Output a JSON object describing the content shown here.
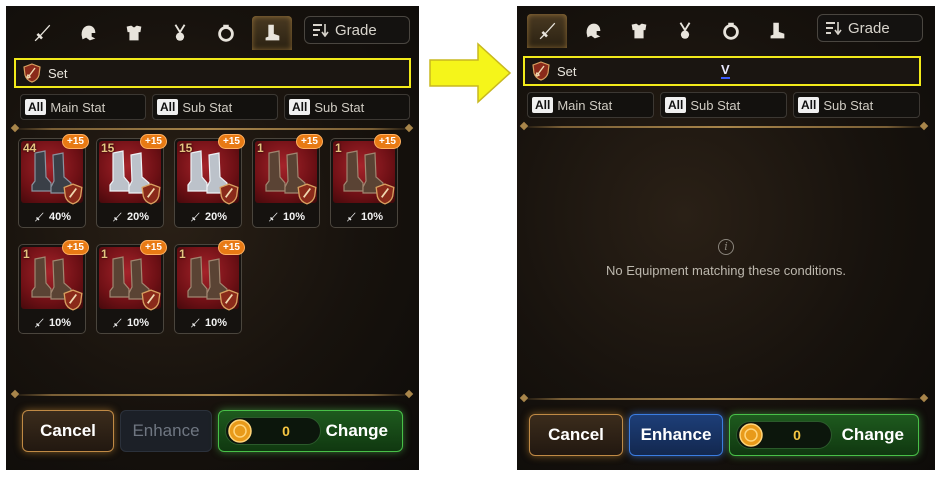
{
  "common": {
    "grade_label": "Grade",
    "set_label": "Set",
    "all_tag": "All",
    "main_stat_label": "Main Stat",
    "sub_stat_label": "Sub Stat"
  },
  "left_panel": {
    "items": [
      {
        "level": "44",
        "plus": "+15",
        "stat": "40%",
        "type": "dark"
      },
      {
        "level": "15",
        "plus": "+15",
        "stat": "20%",
        "type": "silver"
      },
      {
        "level": "15",
        "plus": "+15",
        "stat": "20%",
        "type": "silver"
      },
      {
        "level": "1",
        "plus": "+15",
        "stat": "10%",
        "type": "leather"
      },
      {
        "level": "1",
        "plus": "+15",
        "stat": "10%",
        "type": "leather"
      },
      {
        "level": "1",
        "plus": "+15",
        "stat": "10%",
        "type": "leather"
      },
      {
        "level": "1",
        "plus": "+15",
        "stat": "10%",
        "type": "leather"
      },
      {
        "level": "1",
        "plus": "+15",
        "stat": "10%",
        "type": "leather"
      }
    ],
    "buttons": {
      "cancel": "Cancel",
      "enhance": "Enhance",
      "coin_value": "0",
      "change": "Change"
    }
  },
  "right_panel": {
    "cursor_text": "V",
    "empty_message": "No Equipment matching these conditions.",
    "buttons": {
      "cancel": "Cancel",
      "enhance": "Enhance",
      "coin_value": "0",
      "change": "Change"
    }
  },
  "icons": [
    "sword-icon",
    "helmet-icon",
    "armor-icon",
    "necklace-icon",
    "ring-icon",
    "boots-icon",
    "sort-icon",
    "set-shield-icon",
    "coin-icon",
    "info-icon"
  ],
  "colors": {
    "highlight": "#f2ea1a",
    "arrow": "#f5f51a",
    "coin_text": "#f5c542",
    "change_green": "#48c048",
    "enhance_blue": "#3a7ce0"
  }
}
